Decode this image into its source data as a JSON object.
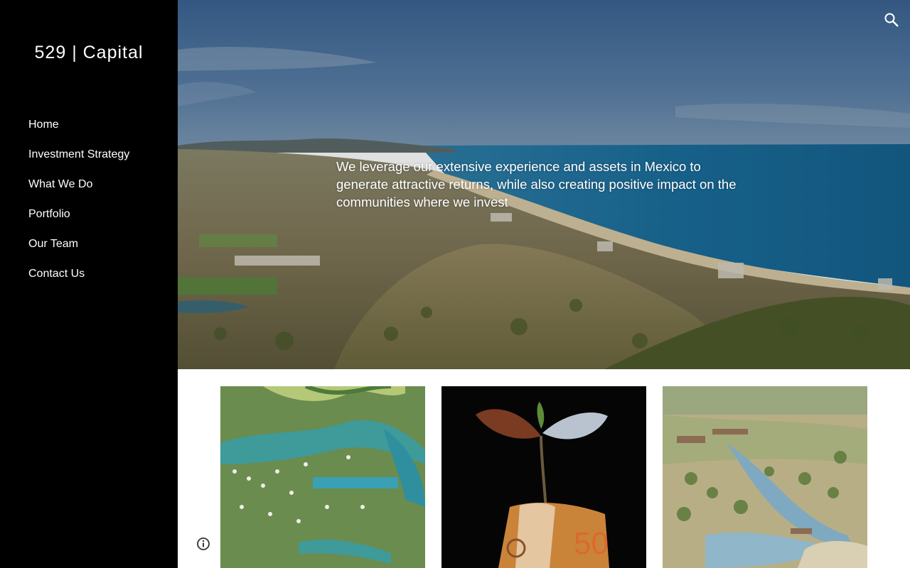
{
  "site": {
    "title": "529 | Capital"
  },
  "nav": {
    "items": [
      {
        "label": "Home"
      },
      {
        "label": "Investment Strategy"
      },
      {
        "label": "What We Do"
      },
      {
        "label": "Portfolio"
      },
      {
        "label": "Our Team"
      },
      {
        "label": "Contact Us"
      }
    ]
  },
  "hero": {
    "text": "We leverage our extensive experience and assets in Mexico to generate attractive returns, while also creating positive impact on the communities where we invest",
    "image": "coastal-landscape-photo"
  },
  "header": {
    "search_icon": "search-icon"
  },
  "cards": [
    {
      "image": "resort-masterplan-aerial"
    },
    {
      "image": "seedling-in-euro-banknote"
    },
    {
      "image": "desert-resort-rendering"
    }
  ],
  "footer": {
    "info_icon": "info-icon"
  },
  "colors": {
    "sidebar_bg": "#000000",
    "text_on_dark": "#ffffff",
    "sea": "#1f6f9c",
    "sky": "#3f6a9a"
  }
}
